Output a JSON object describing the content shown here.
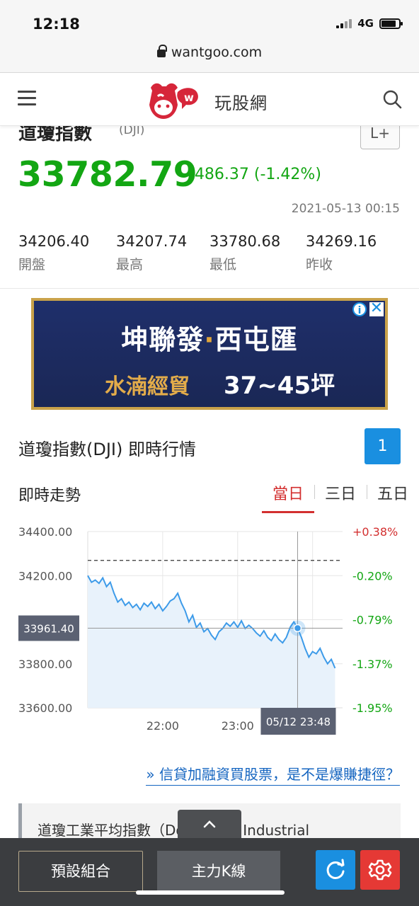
{
  "status": {
    "time": "12:18",
    "network": "4G"
  },
  "browser": {
    "url": "wantgoo.com"
  },
  "header": {
    "brand": "玩股網"
  },
  "quote": {
    "name": "道瓊指數",
    "code": "(DJI)",
    "add_label": "L+",
    "price": "33782.79",
    "change": "-486.37 (-1.42%)",
    "datetime": "2021-05-13 00:15",
    "stats": [
      {
        "value": "34206.40",
        "label": "開盤"
      },
      {
        "value": "34207.74",
        "label": "最高"
      },
      {
        "value": "33780.68",
        "label": "最低"
      },
      {
        "value": "34269.16",
        "label": "昨收"
      }
    ],
    "up_color": "#d32f2f",
    "down_color": "#13a613"
  },
  "ad": {
    "line1a": "坤聯發",
    "dot": "·",
    "line1b": "西屯匯",
    "line2a": "水湳經貿",
    "line2b": "37~45坪",
    "info_icon": "i",
    "close_icon": "✕"
  },
  "section": {
    "title": "道瓊指數(DJI) 即時行情",
    "badge": "1",
    "trend_label": "即時走勢",
    "tabs": [
      {
        "label": "當日",
        "active": true
      },
      {
        "label": "三日",
        "active": false
      },
      {
        "label": "五日",
        "active": false
      }
    ]
  },
  "chart_data": {
    "type": "line",
    "title": "",
    "y_ticks": [
      "34400.00",
      "34200.00",
      "34000.00",
      "33800.00",
      "33600.00"
    ],
    "y_tick_values": [
      34400,
      34200,
      34000,
      33800,
      33600
    ],
    "pct_ticks": [
      "+0.38%",
      "-0.20%",
      "-0.79%",
      "-1.37%",
      "-1.95%"
    ],
    "x_ticks": [
      "22:00",
      "23:00"
    ],
    "ylim": [
      33600,
      34400
    ],
    "x_minutes": [
      21,
      24.4
    ],
    "prev_close": 34269.16,
    "crosshair": {
      "y_label": "33961.40",
      "x_label": "05/12 23:48",
      "x_hour": 23.8,
      "value": 33961.4
    },
    "x": [
      21.0,
      21.05,
      21.1,
      21.15,
      21.2,
      21.25,
      21.3,
      21.35,
      21.4,
      21.45,
      21.5,
      21.55,
      21.6,
      21.65,
      21.7,
      21.75,
      21.8,
      21.85,
      21.9,
      21.95,
      22.0,
      22.05,
      22.1,
      22.15,
      22.2,
      22.25,
      22.3,
      22.35,
      22.4,
      22.45,
      22.5,
      22.55,
      22.6,
      22.65,
      22.7,
      22.75,
      22.8,
      22.85,
      22.9,
      22.95,
      23.0,
      23.05,
      23.1,
      23.15,
      23.2,
      23.25,
      23.3,
      23.35,
      23.4,
      23.45,
      23.5,
      23.55,
      23.6,
      23.65,
      23.7,
      23.75,
      23.8,
      23.85,
      23.9,
      23.95,
      24.0,
      24.05,
      24.1,
      24.15,
      24.2,
      24.25,
      24.3
    ],
    "series": [
      {
        "values": [
          34200,
          34170,
          34180,
          34165,
          34190,
          34150,
          34170,
          34120,
          34080,
          34095,
          34065,
          34080,
          34055,
          34070,
          34045,
          34075,
          34060,
          34080,
          34050,
          34070,
          34040,
          34060,
          34085,
          34095,
          34120,
          34075,
          34040,
          33990,
          34020,
          33965,
          33985,
          33945,
          33960,
          33930,
          33910,
          33945,
          33960,
          33985,
          33970,
          33990,
          33965,
          33995,
          33960,
          33975,
          33960,
          33940,
          33925,
          33950,
          33920,
          33905,
          33935,
          33910,
          33895,
          33920,
          33965,
          33990,
          33961,
          33920,
          33870,
          33830,
          33855,
          33845,
          33870,
          33830,
          33800,
          33820,
          33780
        ]
      }
    ]
  },
  "article_link": "» 信貸加融資買股票，是不是爆賺捷徑？",
  "info_card": "道瓊工業平均指數（Dow Jones Industrial",
  "bottom": {
    "preset": "預設組合",
    "kline": "主力K線"
  }
}
